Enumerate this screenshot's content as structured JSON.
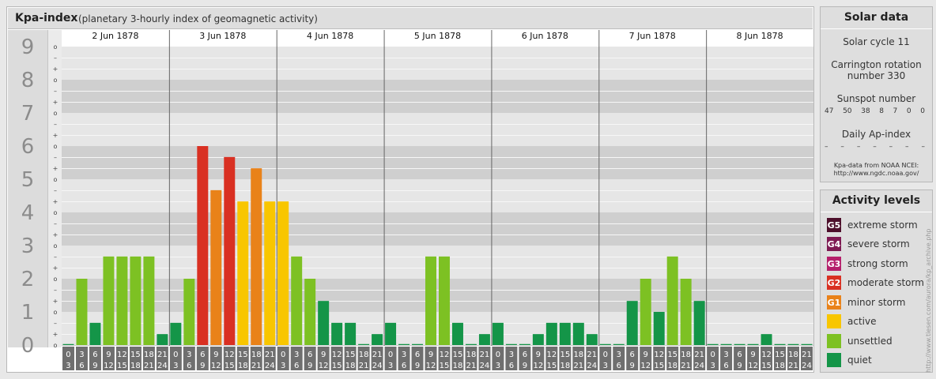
{
  "header": {
    "title": "Kpa-index",
    "subtitle": "(planetary 3-hourly index of geomagnetic activity)"
  },
  "chart_data": {
    "type": "bar",
    "days": [
      "2 Jun 1878",
      "3 Jun 1878",
      "4 Jun 1878",
      "5 Jun 1878",
      "6 Jun 1878",
      "7 Jun 1878",
      "8 Jun 1878"
    ],
    "interval_starts": [
      "0",
      "3",
      "6",
      "9",
      "12",
      "15",
      "18",
      "21"
    ],
    "interval_ends": [
      "3",
      "6",
      "9",
      "12",
      "15",
      "18",
      "21",
      "24"
    ],
    "y_ticks": [
      "0",
      "1",
      "2",
      "3",
      "4",
      "5",
      "6",
      "7",
      "8",
      "9"
    ],
    "sub_ticks": [
      "o",
      "+",
      "–"
    ],
    "ylim": [
      0,
      9
    ],
    "grid": true,
    "values": [
      [
        0,
        2,
        0.67,
        2.67,
        2.67,
        2.67,
        2.67,
        0.33
      ],
      [
        0.67,
        2,
        6,
        4.67,
        5.67,
        4.33,
        5.33,
        4.33
      ],
      [
        4.33,
        2.67,
        2,
        1.33,
        0.67,
        0.67,
        0,
        0.33
      ],
      [
        0.67,
        0,
        0,
        2.67,
        2.67,
        0.67,
        0,
        0.33
      ],
      [
        0.67,
        0,
        0,
        0.33,
        0.67,
        0.67,
        0.67,
        0.33
      ],
      [
        0,
        0,
        1.33,
        2,
        1,
        2.67,
        2,
        1.33
      ],
      [
        0,
        0,
        0,
        0,
        0.33,
        0,
        0,
        0
      ]
    ]
  },
  "solar": {
    "title": "Solar data",
    "cycle": "Solar cycle 11",
    "carrington_1": "Carrington rotation",
    "carrington_2": "number 330",
    "sunspot_label": "Sunspot number",
    "sunspot_values": [
      "47",
      "50",
      "38",
      "8",
      "7",
      "0",
      "0"
    ],
    "ap_label": "Daily Ap-index",
    "ap_values": [
      "–",
      "–",
      "–",
      "–",
      "–",
      "–",
      "–"
    ],
    "source_1": "Kpa-data from NOAA NCEI:",
    "source_2": "http://www.ngdc.noaa.gov/"
  },
  "activity": {
    "title": "Activity levels",
    "levels": [
      {
        "badge": "G5",
        "label": "extreme storm",
        "color": "#4d0f2b"
      },
      {
        "badge": "G4",
        "label": "severe storm",
        "color": "#7e1a52"
      },
      {
        "badge": "G3",
        "label": "strong storm",
        "color": "#b51f6b"
      },
      {
        "badge": "G2",
        "label": "moderate storm",
        "color": "#d93022"
      },
      {
        "badge": "G1",
        "label": "minor storm",
        "color": "#e98219"
      },
      {
        "badge": "",
        "label": "active",
        "color": "#f8c600"
      },
      {
        "badge": "",
        "label": "unsettled",
        "color": "#7dc123"
      },
      {
        "badge": "",
        "label": "quiet",
        "color": "#149548"
      }
    ]
  },
  "footer": {
    "url": "http://www.tiesen.com/aurora/kp_archive.php"
  }
}
